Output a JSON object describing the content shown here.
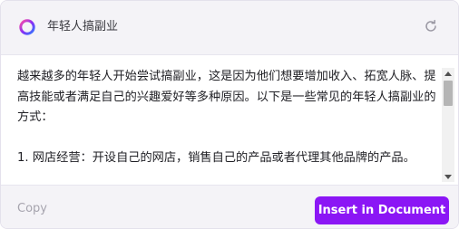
{
  "header": {
    "title": "年轻人搞副业",
    "logo_icon": "gradient-ring-logo",
    "refresh_icon": "refresh-icon"
  },
  "content": {
    "paragraphs": "越来越多的年轻人开始尝试搞副业，这是因为他们想要增加收入、拓宽人脉、提高技能或者满足自己的兴趣爱好等多种原因。以下是一些常见的年轻人搞副业的方式：\n\n1. 网店经营：开设自己的网店，销售自己的产品或者代理其他品牌的产品。"
  },
  "footer": {
    "copy_label": "Copy",
    "insert_label": "Insert in Document"
  },
  "colors": {
    "accent": "#8b16f5",
    "header_bg": "#f4f3f7",
    "muted_text": "#a6a4ae"
  }
}
